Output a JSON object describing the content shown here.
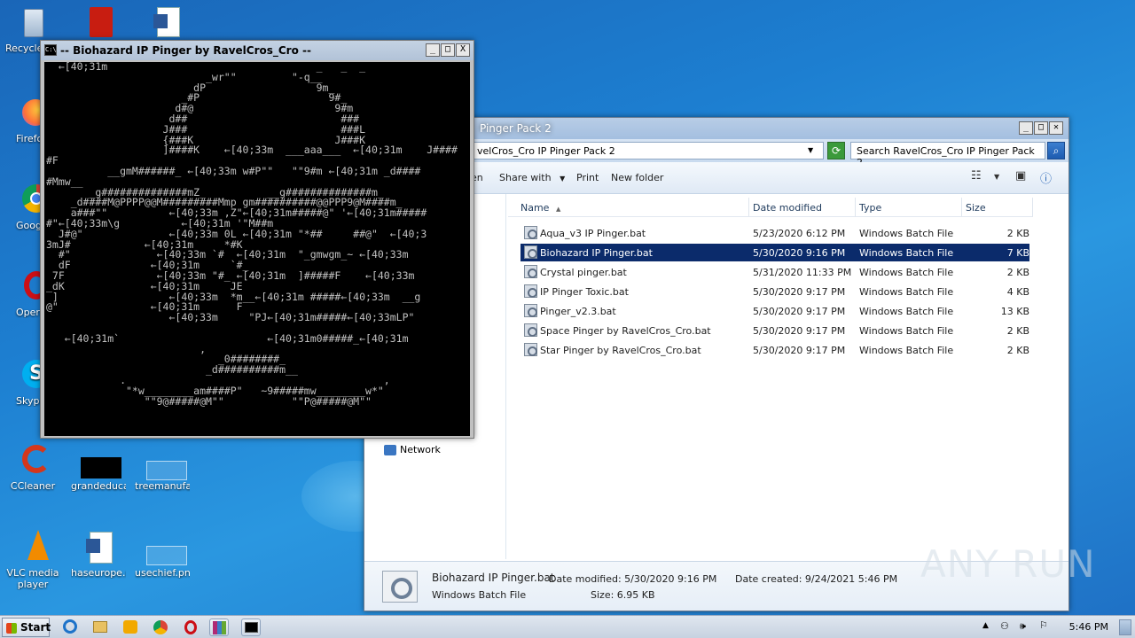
{
  "desktop": {
    "icons": [
      {
        "label": "Recycle Bin",
        "color": "#9fb6cf"
      },
      {
        "label": "",
        "color": "#c81d11"
      },
      {
        "label": "",
        "color": "#2b5797"
      },
      {
        "label": "Firefox",
        "color": "#ff7139"
      },
      {
        "label": "Google Chrome",
        "color": "#4285f4"
      },
      {
        "label": "Opera",
        "color": "#cc0f16"
      },
      {
        "label": "Skype",
        "color": "#00aff0"
      },
      {
        "label": "CCleaner",
        "color": "#d4371c"
      },
      {
        "label": "grandeduca...",
        "color": "#000000"
      },
      {
        "label": "treemanufa...",
        "color": "#ffffff"
      },
      {
        "label": "VLC media player",
        "color": "#f28b00"
      },
      {
        "label": "haseurope.rtf",
        "color": "#2b5797"
      },
      {
        "label": "usechief.png",
        "color": "#ffffff"
      }
    ]
  },
  "console": {
    "title": "-- Biohazard IP Pinger by RavelCros_Cro --",
    "icon_text": "C:\\",
    "buttons": [
      "_",
      "□",
      "X"
    ],
    "text": "  ←[40;31m                                  _   _  _\n                          _wr\"\"         \"-q__\n                        dP                  9m_\n                      _#P                     9#_\n                     d#@                       9#m\n                    d##                         ###\n                   J###                         ###L\n                   {###K                       J###K\n                   ]####K    ←[40;33m  ___aaa___  ←[40;31m    J####\n#F\n          __gmM######_ ←[40;33m w#P\"\"   \"\"9#m ←[40;31m _d####\n#Mmw__\n       _g##############mZ_          __g##############m_\n    _d####M@PPPP@@M#########Mmp gm##########@@PPP9@M####m_\n    a###\"\"          ←[40;33m ,Z\"←[40;31m#####@\" '←[40;31m#####\n#\"←[40;33m\\g          ←[40;31m '\"M##m\n  J#@\"              ←[40;33m 0L ←[40;31m \"*##     ##@\"  ←[40;3\n3mJ#            ←[40;31m     *#K\n  #\"              ←[40;33m `#  ←[40;31m  \"_gmwgm_~ ←[40;33m\n  dF             ←[40;31m     `#_\n 7F               ←[40;33m \"#_ ←[40;31m  ]#####F    ←[40;33m\n_dK              ←[40;31m     JE\n ]                  ←[40;33m  *m__←[40;31m #####←[40;33m  __g\n@\"               ←[40;31m      F\n                    ←[40;33m     \"PJ←[40;31m#####←[40;33mLP\"\n\n   ←[40;31m`                        ←[40;31m0#####_←[40;31m\n                         ,\n                            _0########_\n                          _d##########m__\n            .                                          ,\n             \"*w________am####P\"   ~9#####mw________w*\"\n                \"\"9@#####@M\"\"           \"\"P@#####@M\"\""
  },
  "explorer": {
    "title": "Pinger Pack 2",
    "address": "velCros_Cro IP Pinger Pack 2",
    "search_placeholder": "Search RavelCros_Cro IP Pinger Pack 2",
    "toolbar": {
      "share": "Share with",
      "print": "Print",
      "new_folder": "New folder",
      "en": "en"
    },
    "columns": [
      "Name",
      "Date modified",
      "Type",
      "Size"
    ],
    "files": [
      {
        "name": "Aqua_v3 IP Pinger.bat",
        "date": "5/23/2020 6:12 PM",
        "type": "Windows Batch File",
        "size": "2 KB",
        "selected": false
      },
      {
        "name": "Biohazard IP Pinger.bat",
        "date": "5/30/2020 9:16 PM",
        "type": "Windows Batch File",
        "size": "7 KB",
        "selected": true
      },
      {
        "name": "Crystal pinger.bat",
        "date": "5/31/2020 11:33 PM",
        "type": "Windows Batch File",
        "size": "2 KB",
        "selected": false
      },
      {
        "name": "IP Pinger Toxic.bat",
        "date": "5/30/2020 9:17 PM",
        "type": "Windows Batch File",
        "size": "4 KB",
        "selected": false
      },
      {
        "name": "Pinger_v2.3.bat",
        "date": "5/30/2020 9:17 PM",
        "type": "Windows Batch File",
        "size": "13 KB",
        "selected": false
      },
      {
        "name": "Space Pinger by RavelCros_Cro.bat",
        "date": "5/30/2020 9:17 PM",
        "type": "Windows Batch File",
        "size": "2 KB",
        "selected": false
      },
      {
        "name": "Star Pinger by RavelCros_Cro.bat",
        "date": "5/30/2020 9:17 PM",
        "type": "Windows Batch File",
        "size": "2 KB",
        "selected": false
      }
    ],
    "nav_network": "Network",
    "details": {
      "name": "Biohazard IP Pinger.bat",
      "type": "Windows Batch File",
      "modified": "Date modified: 5/30/2020 9:16 PM",
      "size": "Size: 6.95 KB",
      "created": "Date created: 9/24/2021 5:46 PM"
    }
  },
  "taskbar": {
    "start": "Start",
    "clock": "5:46 PM"
  },
  "watermark": "ANY RUN"
}
